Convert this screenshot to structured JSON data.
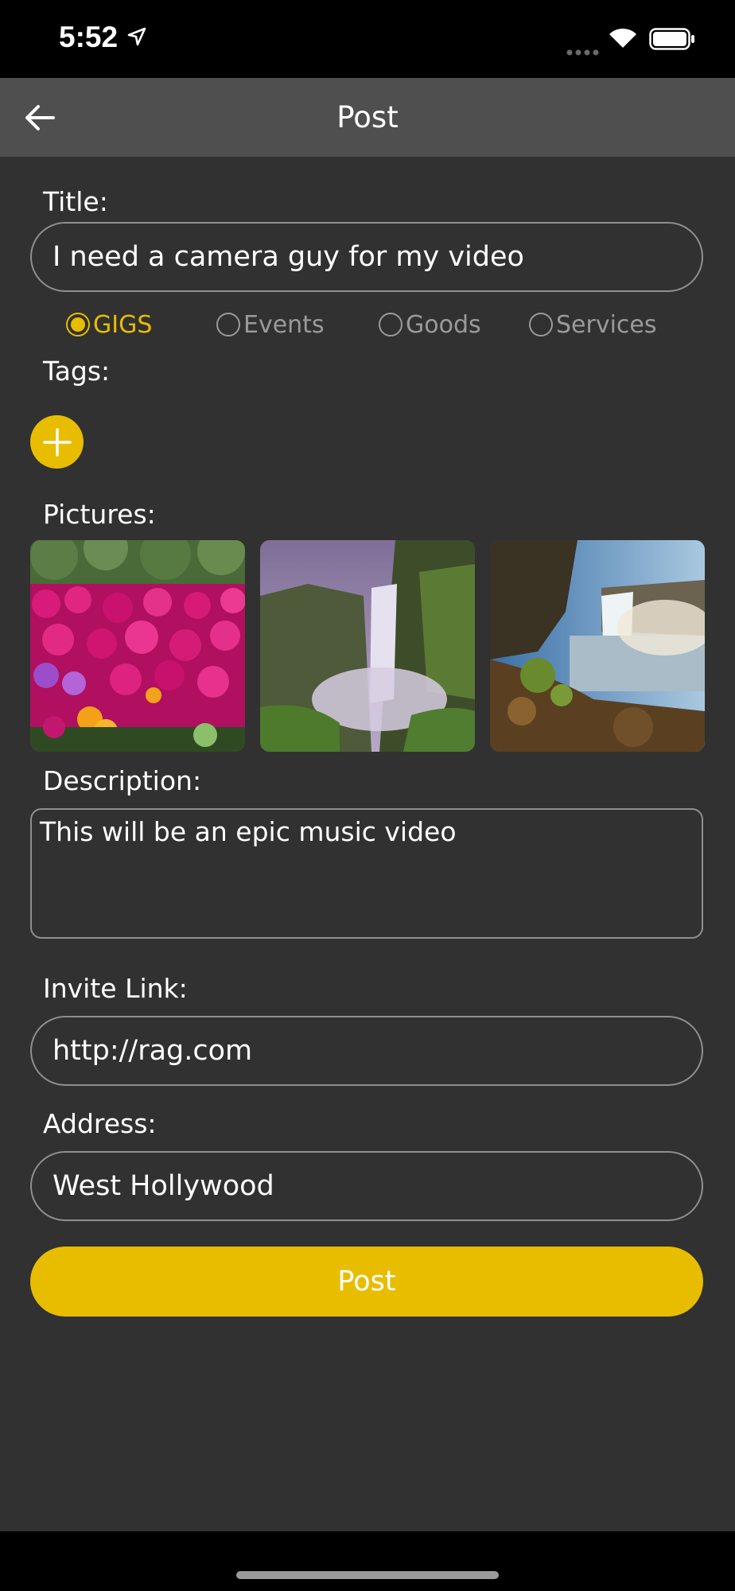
{
  "status_bar": {
    "time": "5:52",
    "icons": [
      "location-arrow-icon",
      "signal-dots-icon",
      "wifi-icon",
      "battery-icon"
    ]
  },
  "nav": {
    "title": "Post",
    "back_icon": "back-arrow-icon"
  },
  "form": {
    "title_label": "Title:",
    "title_value": "I need a camera guy for my video",
    "categories": [
      {
        "label": "GIGS",
        "selected": true
      },
      {
        "label": "Events",
        "selected": false
      },
      {
        "label": "Goods",
        "selected": false
      },
      {
        "label": "Services",
        "selected": false
      }
    ],
    "tags_label": "Tags:",
    "add_tag_icon": "plus-icon",
    "pictures_label": "Pictures:",
    "pictures": [
      "flowers-photo",
      "waterfall-photo",
      "waterfall-rocks-photo"
    ],
    "description_label": "Description:",
    "description_value": "This will be an epic music video",
    "invite_label": "Invite Link:",
    "invite_value": "http://rag.com",
    "address_label": "Address:",
    "address_value": "West Hollywood",
    "submit_label": "Post"
  },
  "colors": {
    "accent": "#e8bd00",
    "background": "#313131",
    "nav_bar": "#4f4f4f",
    "border": "#8f8f8f"
  }
}
